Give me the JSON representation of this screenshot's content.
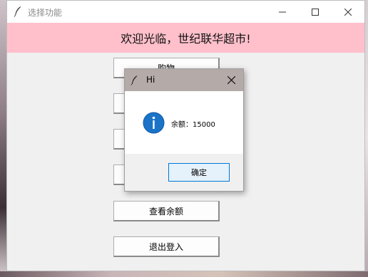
{
  "window": {
    "title": "选择功能",
    "banner": "欢迎光临，世纪联华超市!"
  },
  "menu": {
    "buttons": [
      {
        "label": "购物"
      },
      {
        "label": ""
      },
      {
        "label": ""
      },
      {
        "label": ""
      },
      {
        "label": "查看余额"
      },
      {
        "label": "退出登入"
      }
    ]
  },
  "dialog": {
    "title": "Hi",
    "message": "余额：15000",
    "ok_label": "确定",
    "icon": "info-icon"
  },
  "colors": {
    "banner_bg": "#ffc0cb",
    "dialog_titlebar": "#b4aaa8",
    "accent": "#0078d7"
  }
}
